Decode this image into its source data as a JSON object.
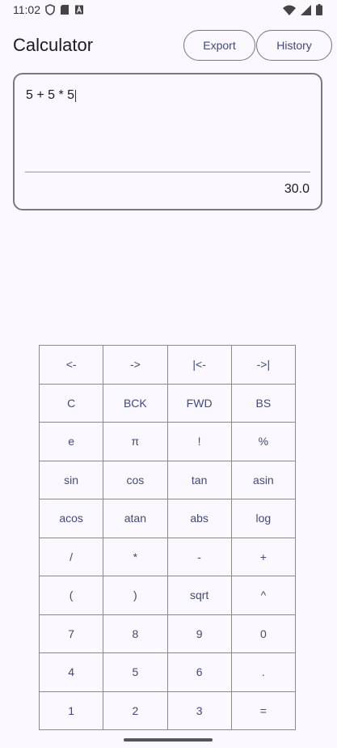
{
  "status_bar": {
    "time": "11:02",
    "left_icons": [
      "shield-icon",
      "sd-card-icon",
      "a-box-icon"
    ],
    "right_icons": [
      "wifi-icon",
      "signal-icon",
      "battery-icon"
    ]
  },
  "header": {
    "title": "Calculator",
    "export_label": "Export",
    "history_label": "History"
  },
  "display": {
    "expression": "5 + 5 * 5",
    "result": "30.0"
  },
  "keypad": {
    "rows": [
      [
        "<-",
        "->",
        "|<-",
        "->|"
      ],
      [
        "C",
        "BCK",
        "FWD",
        "BS"
      ],
      [
        "e",
        "π",
        "!",
        "%"
      ],
      [
        "sin",
        "cos",
        "tan",
        "asin"
      ],
      [
        "acos",
        "atan",
        "abs",
        "log"
      ],
      [
        "/",
        "*",
        "-",
        "+"
      ],
      [
        "(",
        ")",
        "sqrt",
        "^"
      ],
      [
        "7",
        "8",
        "9",
        "0"
      ],
      [
        "4",
        "5",
        "6",
        "."
      ],
      [
        "1",
        "2",
        "3",
        "="
      ]
    ]
  },
  "colors": {
    "background": "#fcf8ff",
    "accent_text": "#3f4a7a",
    "border": "#7a7a80"
  }
}
